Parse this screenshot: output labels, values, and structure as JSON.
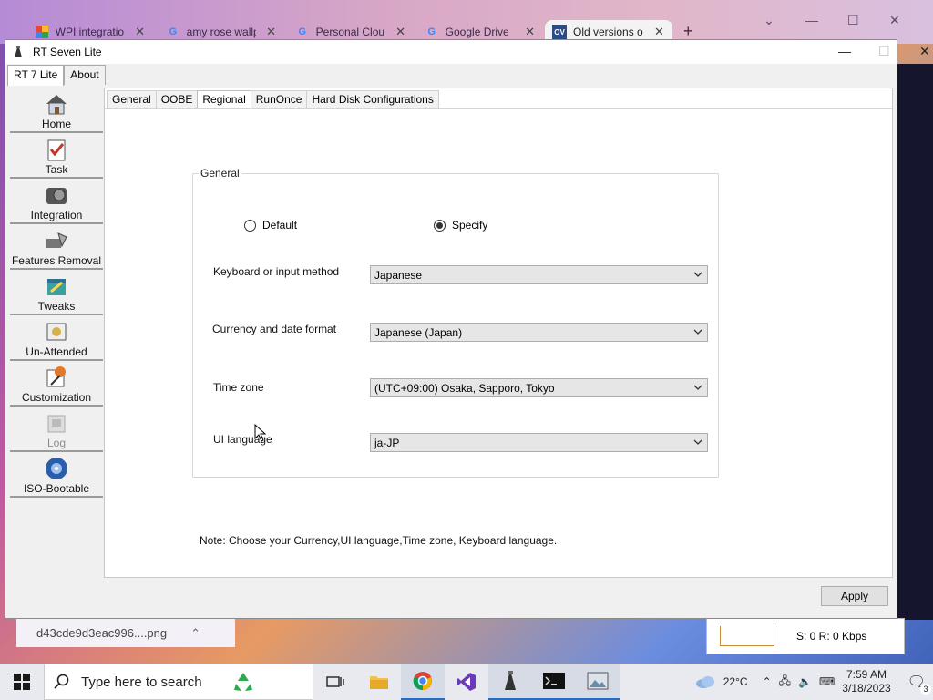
{
  "browser": {
    "tabs": [
      {
        "label": "WPI integratio",
        "favicon": "multicolor-icon"
      },
      {
        "label": "amy rose wallp",
        "favicon": "google-icon"
      },
      {
        "label": "Personal Clou",
        "favicon": "google-icon"
      },
      {
        "label": "Google Drive",
        "favicon": "google-icon"
      },
      {
        "label": "Old versions o",
        "favicon": "ov-icon",
        "favicon_text": "OV"
      }
    ],
    "downloads": {
      "file": "d43cde9d3eac996....png"
    }
  },
  "net_widget": {
    "text": "S: 0 R: 0 Kbps"
  },
  "app": {
    "title": "RT Seven Lite",
    "top_tabs": [
      "RT 7 Lite",
      "About"
    ],
    "nav": [
      {
        "label": "Home",
        "icon": "home-icon"
      },
      {
        "label": "Task",
        "icon": "task-icon"
      },
      {
        "label": "Integration",
        "icon": "integration-icon"
      },
      {
        "label": "Features Removal",
        "icon": "features-removal-icon"
      },
      {
        "label": "Tweaks",
        "icon": "tweaks-icon"
      },
      {
        "label": "Un-Attended",
        "icon": "unattended-icon"
      },
      {
        "label": "Customization",
        "icon": "customization-icon"
      },
      {
        "label": "Log",
        "icon": "log-icon",
        "disabled": true
      },
      {
        "label": "ISO-Bootable",
        "icon": "iso-icon"
      }
    ],
    "sub_tabs": [
      "General",
      "OOBE",
      "Regional",
      "RunOnce",
      "Hard Disk Configurations"
    ],
    "active_sub_tab": "Regional",
    "group": {
      "title": "General",
      "radio_default": "Default",
      "radio_specify": "Specify",
      "selected": "Specify"
    },
    "fields": {
      "keyboard": {
        "label": "Keyboard or input method",
        "value": "Japanese"
      },
      "currency": {
        "label": "Currency and date format",
        "value": "Japanese (Japan)"
      },
      "timezone": {
        "label": "Time zone",
        "value": "(UTC+09:00) Osaka, Sapporo, Tokyo"
      },
      "ui_language": {
        "label": "UI language",
        "value": "ja-JP"
      }
    },
    "note": "Note: Choose your Currency,UI language,Time zone, Keyboard language.",
    "apply": "Apply"
  },
  "taskbar": {
    "search_placeholder": "Type here to search",
    "weather": "22°C",
    "time": "7:59 AM",
    "date": "3/18/2023",
    "notifications": "3"
  },
  "colors": {
    "accent": "#2a6cc4",
    "selected_radio": "#333333"
  }
}
